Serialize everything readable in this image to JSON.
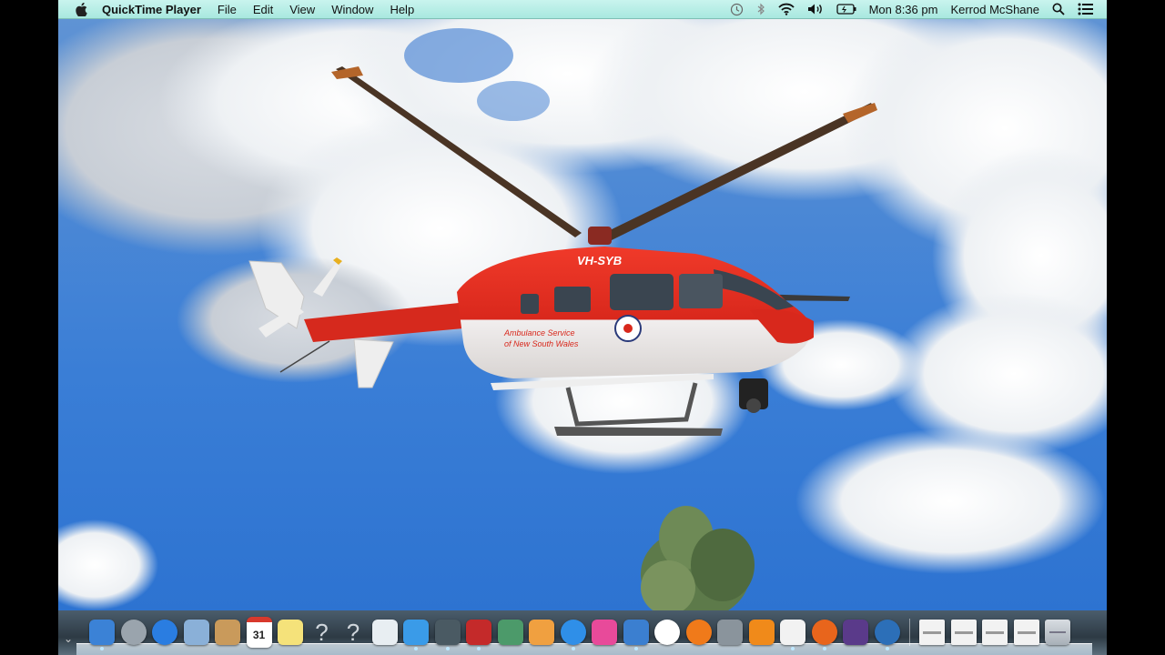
{
  "menubar": {
    "app_name": "QuickTime Player",
    "menus": [
      "File",
      "Edit",
      "View",
      "Window",
      "Help"
    ],
    "clock": "Mon 8:36 pm",
    "user": "Kerrod McShane",
    "status_icons": [
      "time-machine-icon",
      "bluetooth-icon",
      "wifi-icon",
      "volume-icon",
      "battery-icon"
    ]
  },
  "movie": {
    "aircraft_registration": "VH-SYB",
    "livery_line1": "Ambulance Service",
    "livery_line2": "of New South Wales"
  },
  "dock": {
    "apps": [
      {
        "name": "finder",
        "icon": "finder-icon",
        "color": "#3b82d6"
      },
      {
        "name": "launchpad",
        "icon": "rocket-icon",
        "color": "#9aa4ad"
      },
      {
        "name": "safari",
        "icon": "compass-icon",
        "color": "#2a7de1"
      },
      {
        "name": "mail",
        "icon": "stamp-icon",
        "color": "#8ab0d8"
      },
      {
        "name": "contacts",
        "icon": "address-book-icon",
        "color": "#c99a5b"
      },
      {
        "name": "calendar",
        "icon": "calendar-icon",
        "color": "#ffffff",
        "label": "31"
      },
      {
        "name": "notes",
        "icon": "notepad-icon",
        "color": "#f5e27a"
      },
      {
        "name": "unknown-1",
        "icon": "question-mark-icon",
        "label": "?"
      },
      {
        "name": "unknown-2",
        "icon": "question-mark-icon",
        "label": "?"
      },
      {
        "name": "preview",
        "icon": "photos-icon",
        "color": "#e8eef2"
      },
      {
        "name": "messages",
        "icon": "speech-bubble-icon",
        "color": "#3a9be8"
      },
      {
        "name": "facetime",
        "icon": "video-camera-icon",
        "color": "#4a5a63"
      },
      {
        "name": "photo-booth",
        "icon": "photo-booth-icon",
        "color": "#c42a2a"
      },
      {
        "name": "iphoto",
        "icon": "camera-photo-icon",
        "color": "#4c9a6a"
      },
      {
        "name": "pages",
        "icon": "pen-icon",
        "color": "#f0a040"
      },
      {
        "name": "app-store",
        "icon": "app-store-icon",
        "color": "#2f8fe8"
      },
      {
        "name": "keynote-chart",
        "icon": "bar-chart-icon",
        "color": "#e84a9a"
      },
      {
        "name": "keynote",
        "icon": "podium-icon",
        "color": "#3b7fd0"
      },
      {
        "name": "itunes",
        "icon": "music-note-icon",
        "color": "#ffffff"
      },
      {
        "name": "ibooks",
        "icon": "book-icon",
        "color": "#f07a1a"
      },
      {
        "name": "system-preferences",
        "icon": "gear-icon",
        "color": "#8a949c"
      },
      {
        "name": "vlc",
        "icon": "traffic-cone-icon",
        "color": "#f08a1a"
      },
      {
        "name": "textedit",
        "icon": "document-icon",
        "color": "#f2f2f2"
      },
      {
        "name": "firefox",
        "icon": "firefox-icon",
        "color": "#e8651c"
      },
      {
        "name": "imovie",
        "icon": "star-icon",
        "color": "#5a3a8a"
      },
      {
        "name": "quicktime",
        "icon": "quicktime-icon",
        "color": "#2c6fb8"
      }
    ],
    "stacks": [
      {
        "name": "document-stack-1",
        "icon": "document-stack-icon"
      },
      {
        "name": "document-stack-2",
        "icon": "document-stack-icon"
      },
      {
        "name": "document-stack-3",
        "icon": "document-stack-icon"
      },
      {
        "name": "document-stack-4",
        "icon": "document-stack-icon"
      }
    ],
    "trash": {
      "name": "trash",
      "icon": "trash-icon"
    }
  }
}
